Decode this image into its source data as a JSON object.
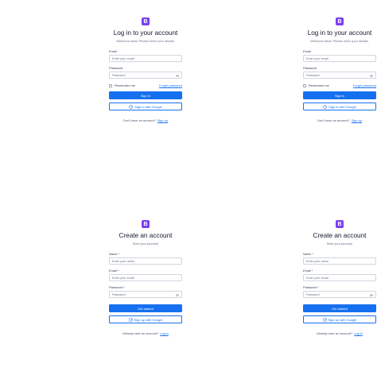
{
  "brand": {
    "logo_letter": "B",
    "accent": "#7a3ff2",
    "primary": "#1570ef"
  },
  "login": {
    "title": "Log in to your account",
    "subtitle": "Welcome back! Please enter your details.",
    "email_label": "Email",
    "email_placeholder": "Enter your email",
    "password_label": "Password",
    "password_placeholder": "Password",
    "remember_label": "Remember me",
    "forgot_link": "Forgot password",
    "sign_in_button": "Sign in",
    "google_button": "Sign in with Google",
    "footer_text": "Don't have an account?",
    "footer_link": "Sign up"
  },
  "signup": {
    "title": "Create an account",
    "subtitle": "Start your journey!",
    "name_label": "Name",
    "name_placeholder": "Enter your name",
    "email_label": "Email",
    "email_placeholder": "Enter your email",
    "password_label": "Password",
    "password_placeholder": "Password",
    "required_mark": "*",
    "get_started_button": "Get started",
    "google_button": "Sign up with Google",
    "footer_text": "Already have an account?",
    "footer_link": "Log in"
  }
}
